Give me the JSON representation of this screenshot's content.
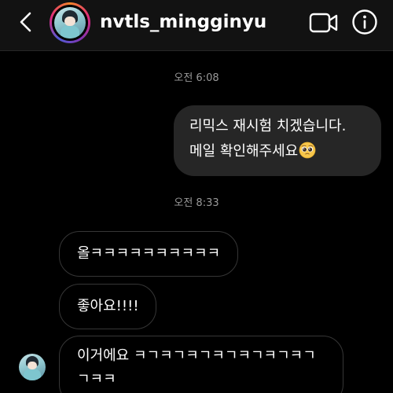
{
  "header": {
    "username": "nvtls_mingginyu",
    "back_icon": "chevron-left-icon",
    "video_icon": "video-camera-icon",
    "info_icon": "info-icon"
  },
  "messages": {
    "time_1": "오전 6:08",
    "sent_1_line_1": "리믹스 재시험 치겠습니다.",
    "sent_1_line_2": "메일 확인해주세요",
    "sent_1_emoji": "pleading-face-emoji",
    "time_2": "오전 8:33",
    "received_1": "올ㅋㅋㅋㅋㅋㅋㅋㅋㅋㅋ",
    "received_2": "좋아요!!!!",
    "received_3_line_1": "이거에요 ㅋㄱㅋㄱㅋㄱㅋㄱㅋㄱㅋㄱㅋㄱ",
    "received_3_line_2": "ㄱㅋㅋ"
  },
  "colors": {
    "background": "#000000",
    "header_background": "#121212",
    "sent_bubble": "#262626",
    "received_bubble_border": "#363636",
    "timestamp_text": "#9a9a9a"
  }
}
